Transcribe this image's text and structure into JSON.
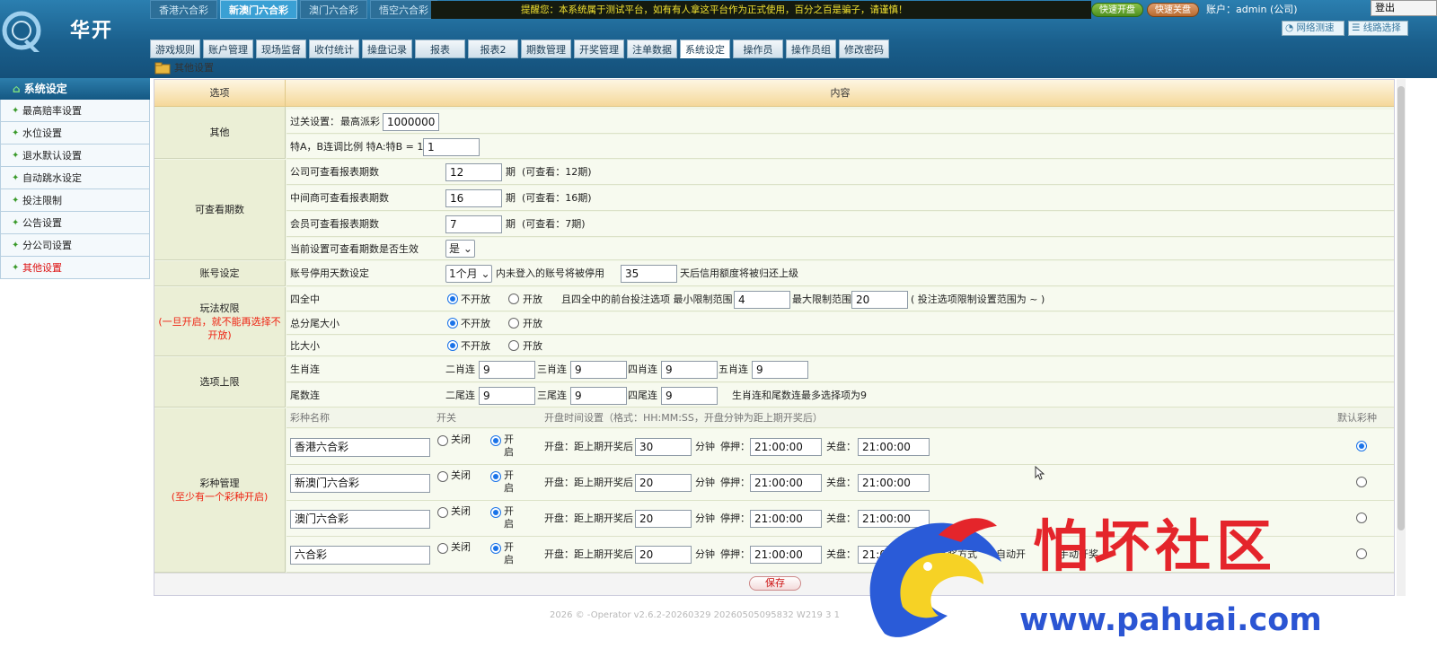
{
  "brand": {
    "name": "华开"
  },
  "lottery_tabs": [
    {
      "label": "香港六合彩",
      "active": false
    },
    {
      "label": "新澳门六合彩",
      "active": true
    },
    {
      "label": "澳门六合彩",
      "active": false
    },
    {
      "label": "悟空六合彩",
      "active": false
    }
  ],
  "notice": "提醒您：本系统属于测试平台，如有有人拿这平台作为正式使用，百分之百是骗子，请谨慎！",
  "speed_buttons": [
    "快速开盘",
    "快速关盘"
  ],
  "account": "账户：admin (公司)",
  "logout_label": "登出",
  "net_test_label": "网络测速",
  "line_select_label": "线路选择",
  "main_tabs": [
    {
      "label": "游戏规则",
      "active": false
    },
    {
      "label": "账户管理",
      "active": false
    },
    {
      "label": "现场监督",
      "active": false
    },
    {
      "label": "收付统计",
      "active": false
    },
    {
      "label": "操盘记录",
      "active": false
    },
    {
      "label": "报表",
      "active": false
    },
    {
      "label": "报表2",
      "active": false
    },
    {
      "label": "期数管理",
      "active": false
    },
    {
      "label": "开奖管理",
      "active": false
    },
    {
      "label": "注单数据",
      "active": false
    },
    {
      "label": "系统设定",
      "active": true
    },
    {
      "label": "操作员",
      "active": false
    },
    {
      "label": "操作员组",
      "active": false
    },
    {
      "label": "修改密码",
      "active": false
    }
  ],
  "breadcrumb": "其他设置",
  "sidebar": {
    "title": "系统设定",
    "items": [
      {
        "label": "最高赔率设置",
        "current": false
      },
      {
        "label": "水位设置",
        "current": false
      },
      {
        "label": "退水默认设置",
        "current": false
      },
      {
        "label": "自动跳水设定",
        "current": false
      },
      {
        "label": "投注限制",
        "current": false
      },
      {
        "label": "公告设置",
        "current": false
      },
      {
        "label": "分公司设置",
        "current": false
      },
      {
        "label": "其他设置",
        "current": true
      }
    ]
  },
  "table": {
    "col_option": "选项",
    "col_content": "内容",
    "other": {
      "label": "其他",
      "pass_label": "过关设置：",
      "max_payout_label": "最高派彩",
      "max_payout": "1000000",
      "ratio_label": "特A，B连调比例 特A:特B = 1:",
      "ratio": "1"
    },
    "periods": {
      "label": "可查看期数",
      "rows": [
        {
          "label": "公司可查看报表期数",
          "value": "12",
          "unit": "期",
          "note": "(可查看：12期)"
        },
        {
          "label": "中间商可查看报表期数",
          "value": "16",
          "unit": "期",
          "note": "(可查看：16期)"
        },
        {
          "label": "会员可查看报表期数",
          "value": "7",
          "unit": "期",
          "note": "(可查看：7期)"
        }
      ],
      "effective_label": "当前设置可查看期数是否生效",
      "effective_value": "是"
    },
    "account_setting": {
      "label": "账号设定",
      "row_label": "账号停用天数设定",
      "duration": "1个月",
      "text1": "内未登入的账号将被停用",
      "days": "35",
      "text2": "天后信用额度将被归还上级"
    },
    "play_permission": {
      "label": "玩法权限",
      "note": "(一旦开启，就不能再选择不开放)",
      "rows": [
        {
          "label": "四全中",
          "off": "不开放",
          "on": "开放",
          "selected": "off"
        },
        {
          "label": "总分尾大小",
          "off": "不开放",
          "on": "开放",
          "selected": "off"
        },
        {
          "label": "比大小",
          "off": "不开放",
          "on": "开放",
          "selected": "off"
        }
      ],
      "extra_text1": "且四全中的前台投注选项 最小限制范围",
      "min_range": "4",
      "extra_text2": "最大限制范围",
      "max_range": "20",
      "extra_text3": "( 投注选项限制设置范围为 ~ )"
    },
    "option_limit": {
      "label": "选项上限",
      "zodiac_label": "生肖连",
      "zodiac": [
        {
          "label": "二肖连",
          "value": "9"
        },
        {
          "label": "三肖连",
          "value": "9"
        },
        {
          "label": "四肖连",
          "value": "9"
        },
        {
          "label": "五肖连",
          "value": "9"
        }
      ],
      "tail_label": "尾数连",
      "tail": [
        {
          "label": "二尾连",
          "value": "9"
        },
        {
          "label": "三尾连",
          "value": "9"
        },
        {
          "label": "四尾连",
          "value": "9"
        }
      ],
      "tail_note": "生肖连和尾数连最多选择项为9"
    },
    "lottery_mgmt": {
      "label": "彩种管理",
      "note": "(至少有一个彩种开启)",
      "headers": {
        "name": "彩种名称",
        "switch": "开关",
        "time": "开盘时间设置（格式：HH:MM:SS，开盘分钟为距上期开奖后）",
        "default": "默认彩种"
      },
      "off_label": "关闭",
      "on_label": "开启",
      "open_label": "开盘：距上期开奖后",
      "minute_label": "分钟",
      "stop_label": "停押：",
      "close_label": "关盘：",
      "rows": [
        {
          "name": "香港六合彩",
          "open_minutes": "30",
          "stop": "21:00:00",
          "close": "21:00:00",
          "default": true
        },
        {
          "name": "新澳门六合彩",
          "open_minutes": "20",
          "stop": "21:00:00",
          "close": "21:00:00",
          "default": false
        },
        {
          "name": "澳门六合彩",
          "open_minutes": "20",
          "stop": "21:00:00",
          "close": "21:00:00",
          "default": false
        },
        {
          "name": "六合彩",
          "open_minutes": "20",
          "stop": "21:00:00",
          "close": "21:00:00",
          "default": false
        }
      ],
      "draw_method_label": "开奖方式",
      "auto_label": "自动开",
      "manual_label": "手动开奖"
    }
  },
  "save_label": "保存",
  "footer": "2026 ©        -Operator v2.6.2-20260329 20260505095832 W219 3 1",
  "watermark": {
    "text": "怕坏社区",
    "url": "www.pahuai.com"
  },
  "colors": {
    "header_blue": "#1a5f8c",
    "active_tab": "#3aa0d4",
    "warning_red": "#e21",
    "radio_blue": "#1a73e8"
  }
}
